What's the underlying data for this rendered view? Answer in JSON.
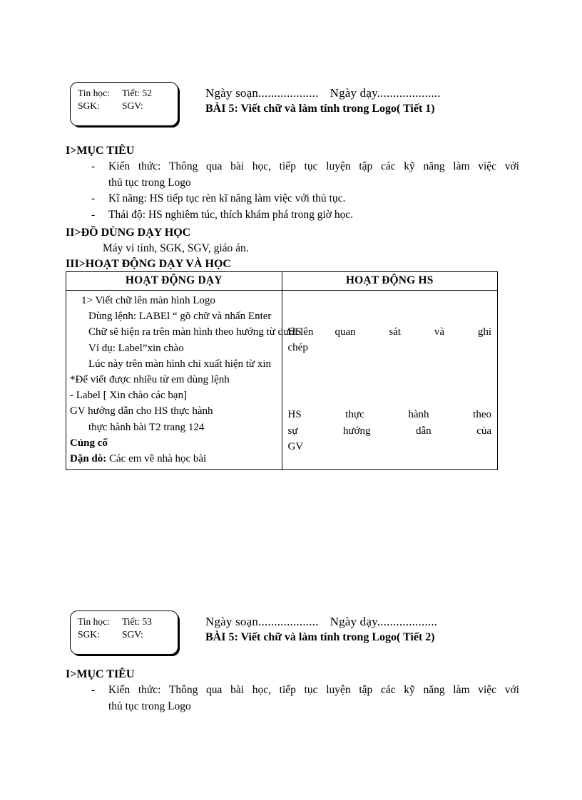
{
  "document": {
    "type": "lesson-plan",
    "language": "vi"
  },
  "lessons": [
    {
      "info_box": {
        "subject_label": "Tin học:",
        "period_label": "Tiết: 52",
        "sgk_label": "SGK:",
        "sgv_label": "SGV:"
      },
      "date_prepared": "Ngày soạn...................",
      "date_taught": "Ngày dạy....................",
      "title": "BÀI 5: Viết chữ và làm tính trong Logo( Tiết 1)",
      "section_i": {
        "heading": "I>MỤC TIÊU",
        "items": [
          {
            "dash": "-",
            "line1": "Kiến thức: Thông qua bài học, tiếp tục luyện tập các kỹ năng làm việc với",
            "line2": "thủ tục trong Logo"
          },
          {
            "dash": "-",
            "line1": "Kĩ năng: HS tiếp tục rèn kĩ năng làm việc với thủ tục.",
            "line2": ""
          },
          {
            "dash": "-",
            "line1": "Thái độ: HS nghiêm túc, thích khám phá trong giờ học.",
            "line2": ""
          }
        ]
      },
      "section_ii": {
        "heading": "II>ĐỒ DÙNG DẠY HỌC",
        "body": "Máy vi tính, SGK, SGV, giáo án."
      },
      "section_iii": {
        "heading": "III>HOẠT ĐỘNG DẠY VÀ HỌC",
        "table": {
          "headers": [
            "HOẠT ĐỘNG DẠY",
            "HOẠT ĐỘNG HS"
          ],
          "teacher_lines": [
            {
              "text": "1> Viết chữ lên màn hình Logo",
              "indent": 1,
              "bold": false
            },
            {
              "text": "Dùng lệnh: LABEl “ gõ chữ và nhấn Enter",
              "indent": 2,
              "bold": false
            },
            {
              "text": "Chữ sẽ hiện ra trên màn hình theo hướng từ dưới lên",
              "indent": 2,
              "bold": false
            },
            {
              "text": "Ví dụ: Label”xin chào",
              "indent": 2,
              "bold": false
            },
            {
              "text": "Lúc này trên màn hình chỉ xuất hiện từ xin",
              "indent": 2,
              "bold": false
            },
            {
              "text": "*Để viết được nhiều từ em dùng lệnh",
              "indent": 0,
              "bold": false
            },
            {
              "text": "- Label [ Xin chào các bạn]",
              "indent": 0,
              "bold": false
            },
            {
              "text": "GV hướng dẫn cho HS thực hành",
              "indent": 0,
              "bold": false
            },
            {
              "text": "thực hành bài T2 trang 124",
              "indent": 2,
              "bold": false
            },
            {
              "text": "Củng cố",
              "indent": 0,
              "bold": true
            },
            {
              "text": "Dặn dò:",
              "indent": 0,
              "bold": true,
              "suffix": " Các em về nhà học bài"
            }
          ],
          "student_blocks": [
            {
              "line1": "HS quan sát và ghi",
              "line2": "chép"
            },
            {
              "line1": "HS thực hành theo",
              "line2": "sự hướng dẫn của",
              "line3": "GV"
            }
          ]
        }
      }
    },
    {
      "info_box": {
        "subject_label": "Tin học:",
        "period_label": "Tiết: 53",
        "sgk_label": "SGK:",
        "sgv_label": "SGV:"
      },
      "date_prepared": "Ngày soạn...................",
      "date_taught": "Ngày dạy...................",
      "title": "BÀI 5: Viết chữ và làm tính trong Logo( Tiết 2)",
      "section_i": {
        "heading": "I>MỤC TIÊU",
        "items": [
          {
            "dash": "-",
            "line1": "Kiến thức: Thông qua bài học, tiếp tục luyện tập các kỹ năng làm việc với",
            "line2": "thủ tục trong Logo"
          }
        ]
      }
    }
  ]
}
